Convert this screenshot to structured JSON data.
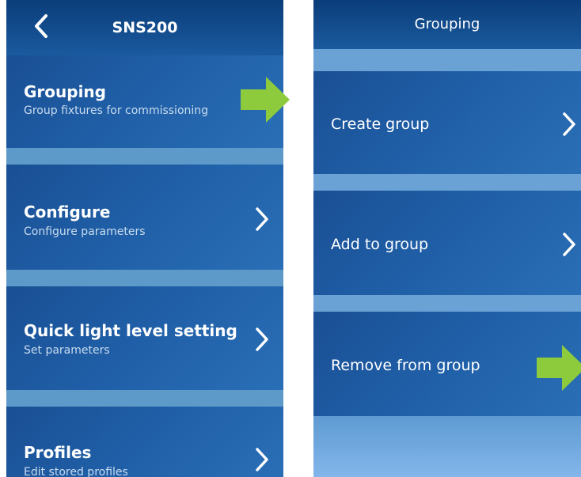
{
  "left_screen": {
    "title": "SNS200",
    "back_icon": "chevron-left-icon",
    "items": [
      {
        "label": "Grouping",
        "sublabel": "Group fixtures for commissioning"
      },
      {
        "label": "Configure",
        "sublabel": "Configure parameters"
      },
      {
        "label": "Quick light level setting",
        "sublabel": "Set parameters"
      },
      {
        "label": "Profiles",
        "sublabel": "Edit stored profiles"
      }
    ]
  },
  "right_screen": {
    "title": "Grouping",
    "items": [
      {
        "label": "Create group"
      },
      {
        "label": "Add to group"
      },
      {
        "label": "Remove from group"
      }
    ]
  },
  "icons": {
    "chevron": "chevron-right-icon",
    "callout_arrow": "green-arrow-icon"
  },
  "colors": {
    "header": "#0b3d7a",
    "tile": "#1f5ea6",
    "band": "#5d9ac9",
    "callout_arrow": "#8dcb3c"
  }
}
